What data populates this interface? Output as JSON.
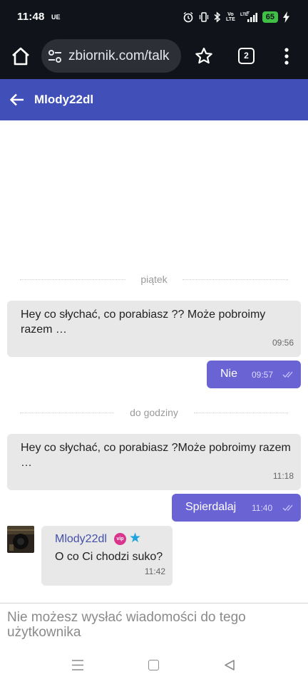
{
  "status_bar": {
    "time": "11:48",
    "carrier_tag": "UE",
    "volte_top": "Vo",
    "volte_bottom": "LTE",
    "battery": "65",
    "icons": [
      "alarm-icon",
      "vibrate-icon",
      "bluetooth-icon",
      "volte-icon",
      "lte-signal-icon",
      "battery-icon",
      "charging-icon"
    ]
  },
  "browser": {
    "url": "zbiornik.com/talk",
    "tab_count": "2",
    "icons": [
      "home-icon",
      "site-settings-icon",
      "bookmark-star-icon",
      "tab-switcher-icon",
      "overflow-menu-icon"
    ]
  },
  "header": {
    "title": "Mlody22dl",
    "background_color": "#4050b8"
  },
  "chat": {
    "dividers": [
      "piątek",
      "do godziny"
    ],
    "messages": [
      {
        "direction": "incoming",
        "text": "Hey co słychać, co porabiasz ?? Może pobroimy razem …",
        "time": "09:56"
      },
      {
        "direction": "outgoing",
        "text": "Nie",
        "time": "09:57"
      },
      {
        "direction": "incoming",
        "text": "Hey co słychać, co porabiasz ?Może pobroimy razem …",
        "time": "11:18"
      },
      {
        "direction": "outgoing",
        "text": "Spierdalaj",
        "time": "11:40"
      },
      {
        "direction": "incoming",
        "sender": "Mlody22dl",
        "badge": "vip",
        "text": "O co Ci chodzi suko?",
        "time": "11:42"
      }
    ],
    "outgoing_color": "#6a63d4",
    "incoming_color": "#e8e8e8"
  },
  "footer": {
    "notice": "Nie możesz wysłać wiadomości do tego użytkownika"
  },
  "nav_bar": {
    "icons": [
      "recents-icon",
      "home-button-icon",
      "back-button-icon"
    ]
  }
}
